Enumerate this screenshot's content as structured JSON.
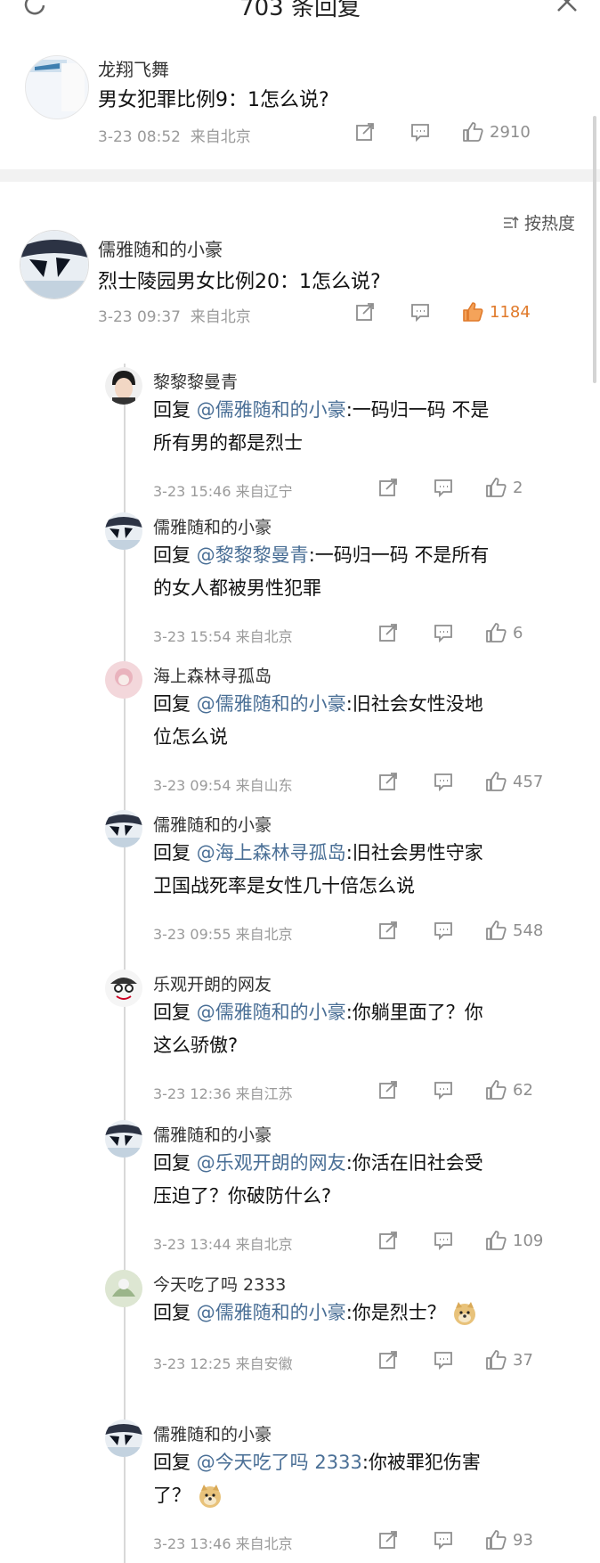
{
  "header": {
    "title": "703 条回复",
    "refresh_icon": "refresh-icon",
    "close_icon": "close-icon"
  },
  "main_comment": {
    "user": "龙翔飞舞",
    "text": "男女犯罪比例9：1怎么说?",
    "time": "3-23 08:52",
    "location": "来自北京",
    "likes": "2910"
  },
  "sort": {
    "label": "按热度"
  },
  "top_reply": {
    "user": "儒雅随和的小豪",
    "text": "烈士陵园男女比例20：1怎么说?",
    "time": "3-23 09:37",
    "location": "来自北京",
    "likes": "1184",
    "like_color": "#e07a2b"
  },
  "replies": [
    {
      "user": "黎黎黎曼青",
      "prefix": "回复",
      "mention": "@儒雅随和的小豪",
      "text": ":一码归一码 不是",
      "text2": "所有男的都是烈士",
      "time": "3-23 15:46",
      "location": "来自辽宁",
      "likes": "2"
    },
    {
      "user": "儒雅随和的小豪",
      "prefix": "回复",
      "mention": "@黎黎黎曼青",
      "text": ":一码归一码  不是所有",
      "text2": "的女人都被男性犯罪",
      "time": "3-23 15:54",
      "location": "来自北京",
      "likes": "6"
    },
    {
      "user": "海上森林寻孤岛",
      "prefix": "回复",
      "mention": "@儒雅随和的小豪",
      "text": ":旧社会女性没地",
      "text2": "位怎么说",
      "time": "3-23 09:54",
      "location": "来自山东",
      "likes": "457"
    },
    {
      "user": "儒雅随和的小豪",
      "prefix": "回复",
      "mention": "@海上森林寻孤岛",
      "text": ":旧社会男性守家",
      "text2": "卫国战死率是女性几十倍怎么说",
      "time": "3-23 09:55",
      "location": "来自北京",
      "likes": "548"
    },
    {
      "user": "乐观开朗的网友",
      "prefix": "回复",
      "mention": "@儒雅随和的小豪",
      "text": ":你躺里面了？你",
      "text2": "这么骄傲?",
      "time": "3-23 12:36",
      "location": "来自江苏",
      "likes": "62"
    },
    {
      "user": "儒雅随和的小豪",
      "prefix": "回复",
      "mention": "@乐观开朗的网友",
      "text": ":你活在旧社会受",
      "text2": "压迫了？你破防什么?",
      "time": "3-23 13:44",
      "location": "来自北京",
      "likes": "109"
    },
    {
      "user": "今天吃了吗 2333",
      "prefix": "回复",
      "mention": "@儒雅随和的小豪",
      "text": ":你是烈士？",
      "text2": "",
      "time": "3-23 12:25",
      "location": "来自安徽",
      "likes": "37",
      "emoji": "doge-emoji"
    },
    {
      "user": "儒雅随和的小豪",
      "prefix": "回复",
      "mention": "@今天吃了吗 2333",
      "text": ":你被罪犯伤害",
      "text2": "了？",
      "time": "3-23 13:46",
      "location": "来自北京",
      "likes": "93",
      "emoji2": "doge-emoji"
    }
  ]
}
